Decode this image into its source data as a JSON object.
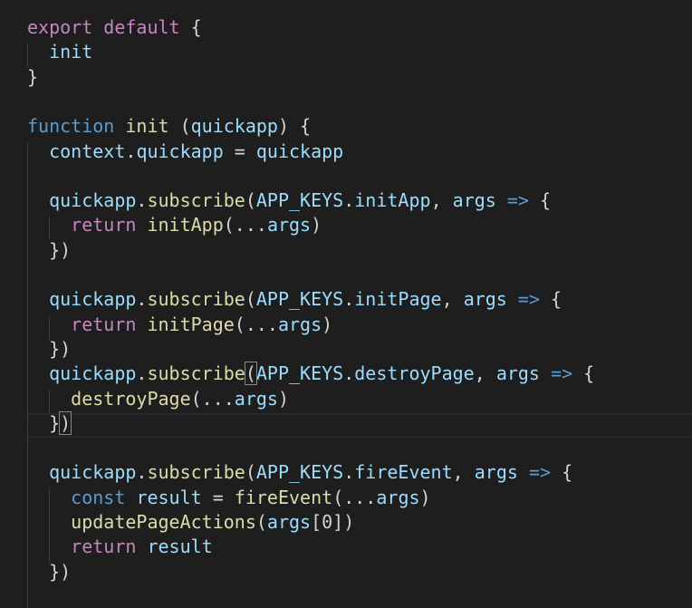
{
  "editor": {
    "language": "javascript",
    "theme": "dark",
    "lines": [
      {
        "tokens": [
          {
            "t": "export",
            "c": "kw-ctl"
          },
          {
            "t": " ",
            "c": "punct"
          },
          {
            "t": "default",
            "c": "kw-ctl"
          },
          {
            "t": " {",
            "c": "punct"
          }
        ]
      },
      {
        "tokens": [
          {
            "t": "  ",
            "c": "punct"
          },
          {
            "t": "init",
            "c": "var"
          }
        ]
      },
      {
        "tokens": [
          {
            "t": "}",
            "c": "punct"
          }
        ]
      },
      {
        "tokens": []
      },
      {
        "tokens": [
          {
            "t": "function",
            "c": "kw"
          },
          {
            "t": " ",
            "c": "punct"
          },
          {
            "t": "init",
            "c": "fn"
          },
          {
            "t": " (",
            "c": "punct"
          },
          {
            "t": "quickapp",
            "c": "var"
          },
          {
            "t": ") {",
            "c": "punct"
          }
        ]
      },
      {
        "tokens": [
          {
            "t": "  ",
            "c": "punct"
          },
          {
            "t": "context",
            "c": "var"
          },
          {
            "t": ".",
            "c": "punct"
          },
          {
            "t": "quickapp",
            "c": "var"
          },
          {
            "t": " = ",
            "c": "punct"
          },
          {
            "t": "quickapp",
            "c": "var"
          }
        ]
      },
      {
        "tokens": []
      },
      {
        "tokens": [
          {
            "t": "  ",
            "c": "punct"
          },
          {
            "t": "quickapp",
            "c": "var"
          },
          {
            "t": ".",
            "c": "punct"
          },
          {
            "t": "subscribe",
            "c": "fn"
          },
          {
            "t": "(",
            "c": "punct"
          },
          {
            "t": "APP_KEYS",
            "c": "var"
          },
          {
            "t": ".",
            "c": "punct"
          },
          {
            "t": "initApp",
            "c": "var"
          },
          {
            "t": ", ",
            "c": "punct"
          },
          {
            "t": "args",
            "c": "var"
          },
          {
            "t": " ",
            "c": "punct"
          },
          {
            "t": "=>",
            "c": "kw"
          },
          {
            "t": " {",
            "c": "punct"
          }
        ]
      },
      {
        "tokens": [
          {
            "t": "    ",
            "c": "punct"
          },
          {
            "t": "return",
            "c": "kw-ctl"
          },
          {
            "t": " ",
            "c": "punct"
          },
          {
            "t": "initApp",
            "c": "fn"
          },
          {
            "t": "(...",
            "c": "punct"
          },
          {
            "t": "args",
            "c": "var"
          },
          {
            "t": ")",
            "c": "punct"
          }
        ]
      },
      {
        "tokens": [
          {
            "t": "  })",
            "c": "punct"
          }
        ]
      },
      {
        "tokens": []
      },
      {
        "tokens": [
          {
            "t": "  ",
            "c": "punct"
          },
          {
            "t": "quickapp",
            "c": "var"
          },
          {
            "t": ".",
            "c": "punct"
          },
          {
            "t": "subscribe",
            "c": "fn"
          },
          {
            "t": "(",
            "c": "punct"
          },
          {
            "t": "APP_KEYS",
            "c": "var"
          },
          {
            "t": ".",
            "c": "punct"
          },
          {
            "t": "initPage",
            "c": "var"
          },
          {
            "t": ", ",
            "c": "punct"
          },
          {
            "t": "args",
            "c": "var"
          },
          {
            "t": " ",
            "c": "punct"
          },
          {
            "t": "=>",
            "c": "kw"
          },
          {
            "t": " {",
            "c": "punct"
          }
        ]
      },
      {
        "tokens": [
          {
            "t": "    ",
            "c": "punct"
          },
          {
            "t": "return",
            "c": "kw-ctl"
          },
          {
            "t": " ",
            "c": "punct"
          },
          {
            "t": "initPage",
            "c": "fn"
          },
          {
            "t": "(...",
            "c": "punct"
          },
          {
            "t": "args",
            "c": "var"
          },
          {
            "t": ")",
            "c": "punct"
          }
        ]
      },
      {
        "tokens": [
          {
            "t": "  })",
            "c": "punct"
          }
        ]
      },
      {
        "tokens": [
          {
            "t": "  ",
            "c": "punct"
          },
          {
            "t": "quickapp",
            "c": "var"
          },
          {
            "t": ".",
            "c": "punct"
          },
          {
            "t": "subscribe",
            "c": "fn"
          },
          {
            "t": "(",
            "c": "punct bracket-match"
          },
          {
            "t": "APP_KEYS",
            "c": "var"
          },
          {
            "t": ".",
            "c": "punct"
          },
          {
            "t": "destroyPage",
            "c": "var"
          },
          {
            "t": ", ",
            "c": "punct"
          },
          {
            "t": "args",
            "c": "var"
          },
          {
            "t": " ",
            "c": "punct"
          },
          {
            "t": "=>",
            "c": "kw"
          },
          {
            "t": " {",
            "c": "punct"
          }
        ]
      },
      {
        "tokens": [
          {
            "t": "    ",
            "c": "punct"
          },
          {
            "t": "destroyPage",
            "c": "fn"
          },
          {
            "t": "(...",
            "c": "punct"
          },
          {
            "t": "args",
            "c": "var"
          },
          {
            "t": ")",
            "c": "punct"
          }
        ]
      },
      {
        "tokens": [
          {
            "t": "  }",
            "c": "punct"
          },
          {
            "t": ")",
            "c": "punct bracket-match"
          }
        ]
      },
      {
        "tokens": []
      },
      {
        "tokens": [
          {
            "t": "  ",
            "c": "punct"
          },
          {
            "t": "quickapp",
            "c": "var"
          },
          {
            "t": ".",
            "c": "punct"
          },
          {
            "t": "subscribe",
            "c": "fn"
          },
          {
            "t": "(",
            "c": "punct"
          },
          {
            "t": "APP_KEYS",
            "c": "var"
          },
          {
            "t": ".",
            "c": "punct"
          },
          {
            "t": "fireEvent",
            "c": "var"
          },
          {
            "t": ", ",
            "c": "punct"
          },
          {
            "t": "args",
            "c": "var"
          },
          {
            "t": " ",
            "c": "punct"
          },
          {
            "t": "=>",
            "c": "kw"
          },
          {
            "t": " {",
            "c": "punct"
          }
        ]
      },
      {
        "tokens": [
          {
            "t": "    ",
            "c": "punct"
          },
          {
            "t": "const",
            "c": "kw"
          },
          {
            "t": " ",
            "c": "punct"
          },
          {
            "t": "result",
            "c": "var"
          },
          {
            "t": " = ",
            "c": "punct"
          },
          {
            "t": "fireEvent",
            "c": "fn"
          },
          {
            "t": "(...",
            "c": "punct"
          },
          {
            "t": "args",
            "c": "var"
          },
          {
            "t": ")",
            "c": "punct"
          }
        ]
      },
      {
        "tokens": [
          {
            "t": "    ",
            "c": "punct"
          },
          {
            "t": "updatePageActions",
            "c": "fn"
          },
          {
            "t": "(",
            "c": "punct"
          },
          {
            "t": "args",
            "c": "var"
          },
          {
            "t": "[0])",
            "c": "punct"
          }
        ]
      },
      {
        "tokens": [
          {
            "t": "    ",
            "c": "punct"
          },
          {
            "t": "return",
            "c": "kw-ctl"
          },
          {
            "t": " ",
            "c": "punct"
          },
          {
            "t": "result",
            "c": "var"
          }
        ]
      },
      {
        "tokens": [
          {
            "t": "  })",
            "c": "punct"
          }
        ]
      }
    ]
  }
}
